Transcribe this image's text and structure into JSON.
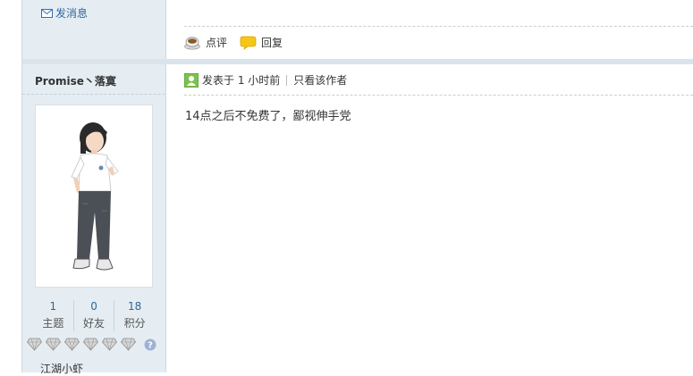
{
  "previous_post": {
    "send_message": "发消息",
    "actions": {
      "comment": "点评",
      "reply": "回复"
    }
  },
  "author": {
    "name": "Promise丶落寞",
    "stats": [
      {
        "value": "1",
        "label": "主题"
      },
      {
        "value": "0",
        "label": "好友"
      },
      {
        "value": "18",
        "label": "积分"
      }
    ],
    "rank": "江湖小虾",
    "medal_count": 6
  },
  "post": {
    "posted_time": "发表于 1 小时前",
    "only_author": "只看该作者",
    "content": "14点之后不免费了，鄙视伸手党"
  },
  "colors": {
    "sidebar_bg": "#e5edf2",
    "link": "#336699"
  }
}
